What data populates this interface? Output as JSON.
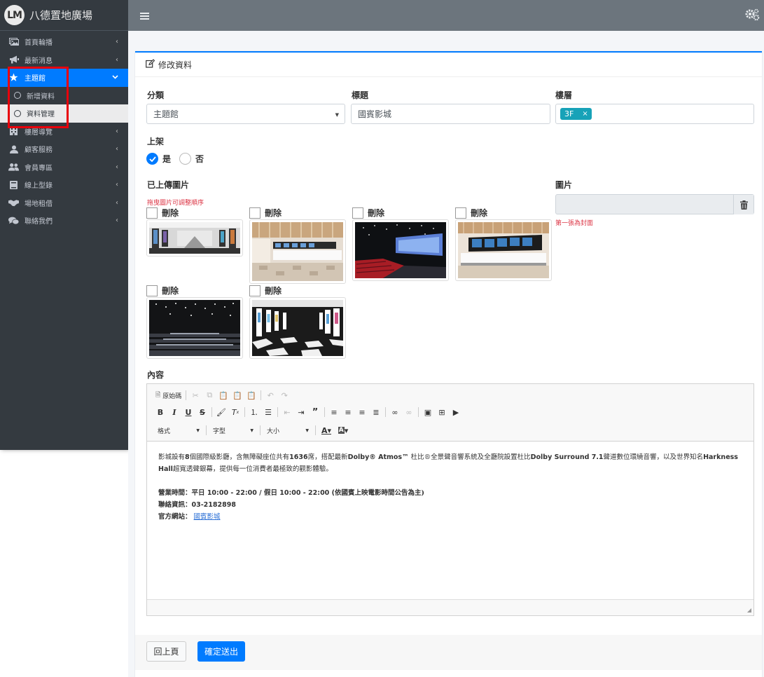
{
  "brand": {
    "logo": "LM",
    "name": "八德置地廣場"
  },
  "sidebar": {
    "items": [
      {
        "label": "首頁輪播",
        "icon": "images-icon"
      },
      {
        "label": "最新消息",
        "icon": "bullhorn-icon"
      },
      {
        "label": "主題館",
        "icon": "star-icon"
      },
      {
        "label": "新增資料"
      },
      {
        "label": "資料管理"
      },
      {
        "label": "樓層導覽",
        "icon": "building-icon"
      },
      {
        "label": "顧客服務",
        "icon": "user-service-icon"
      },
      {
        "label": "會員專區",
        "icon": "users-icon"
      },
      {
        "label": "線上型錄",
        "icon": "book-icon"
      },
      {
        "label": "場地租借",
        "icon": "handshake-icon"
      },
      {
        "label": "聯絡我們",
        "icon": "comments-icon"
      }
    ]
  },
  "colors": {
    "primary": "#007bff",
    "sidebar_bg": "#343a40",
    "topbar_bg": "#6c757d",
    "tag": "#17a2b8",
    "danger": "#dc3545",
    "highlight_box": "#e8000b"
  },
  "card": {
    "title": "修改資料"
  },
  "form": {
    "category_label": "分類",
    "category_value": "主題館",
    "title_label": "標題",
    "title_value": "國賓影城",
    "floor_label": "樓層",
    "floor_tag": "3F",
    "floor_tag_remove": "×",
    "publish_label": "上架",
    "publish_yes": "是",
    "publish_no": "否",
    "uploaded_label": "已上傳圖片",
    "uploaded_hint": "拖曳圖片可調整順序",
    "delete_label": "刪除",
    "image_label": "圖片",
    "image_hint": "第一張為封面",
    "content_label": "內容"
  },
  "editor": {
    "source_label": "原始碼",
    "format_label": "格式",
    "font_label": "字型",
    "size_label": "大小",
    "p1_a": "影城設有",
    "p1_b": "8",
    "p1_c": "個國際級影廳，含無障礙座位共有",
    "p1_d": "1636",
    "p1_e": "席，搭配最新",
    "p1_f": "Dolby® Atmos™",
    "p1_g": " 杜比®全景聲音響系統及全廳院設置杜比",
    "p1_h": "Dolby Surround 7.1",
    "p1_i": "聲道數位環繞音響，以及世界知名",
    "p1_j": "Harkness Hall",
    "p1_k": "超寬透聲銀幕，提供每一位消費者最極致的觀影體驗。",
    "hours_a": "營業時間：平日 ",
    "hours_b": "10:00 - 22:00 / ",
    "hours_c": "假日 ",
    "hours_d": "10:00 - 22:00  (",
    "hours_e": "依國賓上映電影時間公告為主)",
    "contact_a": "聯絡資訊：",
    "contact_b": "03-2182898",
    "site_a": "官方網站：",
    "site_link": "國賓影城"
  },
  "buttons": {
    "back": "回上頁",
    "submit": "確定送出"
  }
}
